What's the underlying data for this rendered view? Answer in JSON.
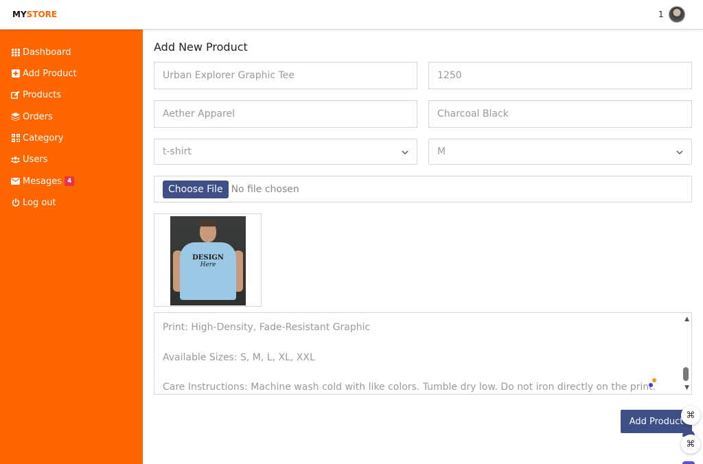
{
  "header": {
    "brand_my": "MY",
    "brand_store": "STORE",
    "notification_count": "1"
  },
  "sidebar": {
    "items": [
      {
        "label": "Dashboard",
        "icon": "grid-icon"
      },
      {
        "label": "Add Product",
        "icon": "plus-square-icon"
      },
      {
        "label": "Products",
        "icon": "edit-icon"
      },
      {
        "label": "Orders",
        "icon": "layers-icon"
      },
      {
        "label": "Category",
        "icon": "qrcode-icon"
      },
      {
        "label": "Users",
        "icon": "users-icon"
      },
      {
        "label": "Mesages",
        "icon": "envelope-icon",
        "badge": "4"
      },
      {
        "label": "Log out",
        "icon": "power-icon"
      }
    ]
  },
  "form": {
    "title": "Add New Product",
    "product_name": "Urban Explorer Graphic Tee",
    "price": "1250",
    "brand": "Aether Apparel",
    "color": "Charcoal Black",
    "category_selected": "t-shirt",
    "size_selected": "M",
    "file_button": "Choose File",
    "file_status": "No file chosen",
    "preview_text_1": "DESIGN",
    "preview_text_2": "Here",
    "description_lines": [
      "Print: High-Density, Fade-Resistant Graphic",
      "Available Sizes: S, M, L, XL, XXL",
      "Care Instructions: Machine wash cold with like colors. Tumble dry low. Do not iron directly on the print."
    ],
    "submit_label": "Add Product"
  },
  "colors": {
    "accent": "#ff6600",
    "primary_button": "#3d4f86",
    "badge": "#e8324a"
  }
}
